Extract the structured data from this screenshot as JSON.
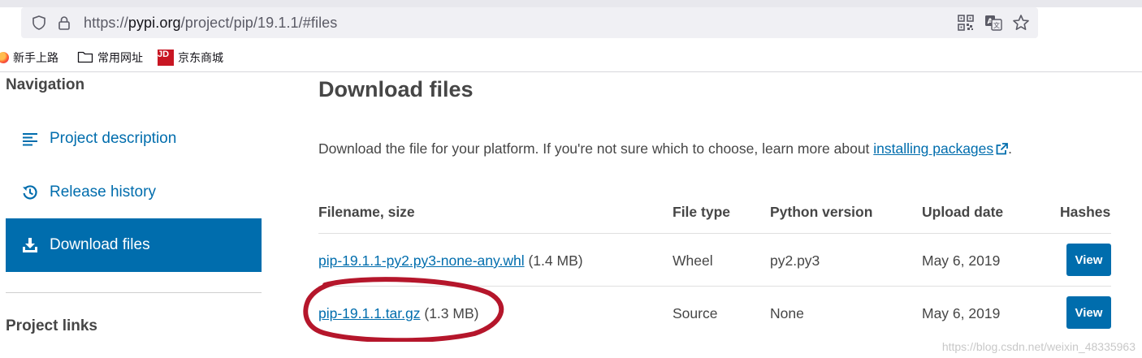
{
  "browser": {
    "url_prefix": "https://",
    "url_host": "pypi.org",
    "url_path": "/project/pip/19.1.1/#files",
    "bookmarks": [
      {
        "label": "新手上路",
        "icon": "firefox-icon"
      },
      {
        "label": "常用网址",
        "icon": "folder-icon"
      },
      {
        "label": "京东商城",
        "icon": "jd-icon",
        "icon_text": "JD"
      }
    ],
    "icons": [
      "shield-icon",
      "lock-icon",
      "qr-code-icon",
      "translate-icon",
      "star-icon"
    ]
  },
  "sidebar": {
    "heading": "Navigation",
    "items": [
      {
        "label": "Project description",
        "icon": "list-icon",
        "active": false
      },
      {
        "label": "Release history",
        "icon": "history-icon",
        "active": false
      },
      {
        "label": "Download files",
        "icon": "download-icon",
        "active": true
      }
    ],
    "links_heading": "Project links"
  },
  "main": {
    "title": "Download files",
    "intro_text": "Download the file for your platform. If you're not sure which to choose, learn more about ",
    "intro_link": "installing packages",
    "intro_end": ".",
    "table": {
      "headers": [
        "Filename, size",
        "File type",
        "Python version",
        "Upload date",
        "Hashes"
      ],
      "rows": [
        {
          "filename": "pip-19.1.1-py2.py3-none-any.whl",
          "size": "(1.4 MB)",
          "file_type": "Wheel",
          "python_version": "py2.py3",
          "upload_date": "May 6, 2019",
          "hash_button": "View"
        },
        {
          "filename": "pip-19.1.1.tar.gz",
          "size": "(1.3 MB)",
          "file_type": "Source",
          "python_version": "None",
          "upload_date": "May 6, 2019",
          "hash_button": "View"
        }
      ]
    }
  },
  "watermark": "https://blog.csdn.net/weixin_48335963",
  "colors": {
    "link": "#006dad",
    "active_bg": "#006dad",
    "annotation": "#b5162b",
    "text": "#464646"
  }
}
